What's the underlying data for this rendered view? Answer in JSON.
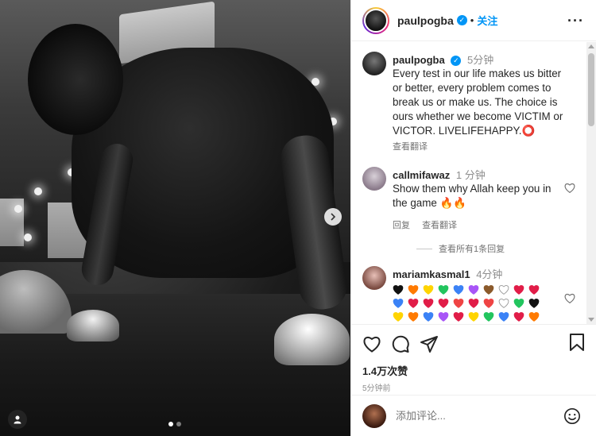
{
  "post": {
    "username": "paulpogba",
    "follow_label": "关注",
    "separator": "•",
    "more_label": "···"
  },
  "caption": {
    "username": "paulpogba",
    "time": "5分钟",
    "text": "Every test in our life makes us bitter or better, every problem comes to break us or make us. The choice is ours whether we become VICTIM or VICTOR. LIVELIFEHAPPY.⭕",
    "translate_label": "查看翻译"
  },
  "comments": [
    {
      "username": "callmifawaz",
      "time": "1 分钟",
      "text": "Show them why Allah keep you in the game 🔥🔥",
      "reply_label": "回复",
      "translate_label": "查看翻译"
    },
    {
      "username": "mariamkasmal1",
      "time": "4分钟"
    }
  ],
  "view_replies_label": "查看所有1条回复",
  "emoji_hearts": [
    "#111111",
    "#ff7a00",
    "#ffd400",
    "#22c55e",
    "#3b82f6",
    "#a855f7",
    "#8b5a2b",
    "#ffffff",
    "#e11d48",
    "#e11d48",
    "#3b82f6",
    "#e11d48",
    "#e11d48",
    "#e11d48",
    "#ef4444",
    "#e11d48",
    "#ef4444",
    "#ffffff",
    "#22c55e",
    "#111111",
    "#ffd400",
    "#ff7a00",
    "#3b82f6",
    "#a855f7",
    "#e11d48",
    "#ffd400",
    "#22c55e",
    "#3b82f6",
    "#e11d48",
    "#ff7a00",
    "#ffffff",
    "#ffffff",
    "#ffffff"
  ],
  "actions": {
    "likes": "1.4万次赞",
    "posted_ago": "5分钟前"
  },
  "add_comment": {
    "placeholder": "添加评论..."
  },
  "colors": {
    "accent": "#0095f6",
    "text": "#262626",
    "muted": "#8e8e8e"
  }
}
